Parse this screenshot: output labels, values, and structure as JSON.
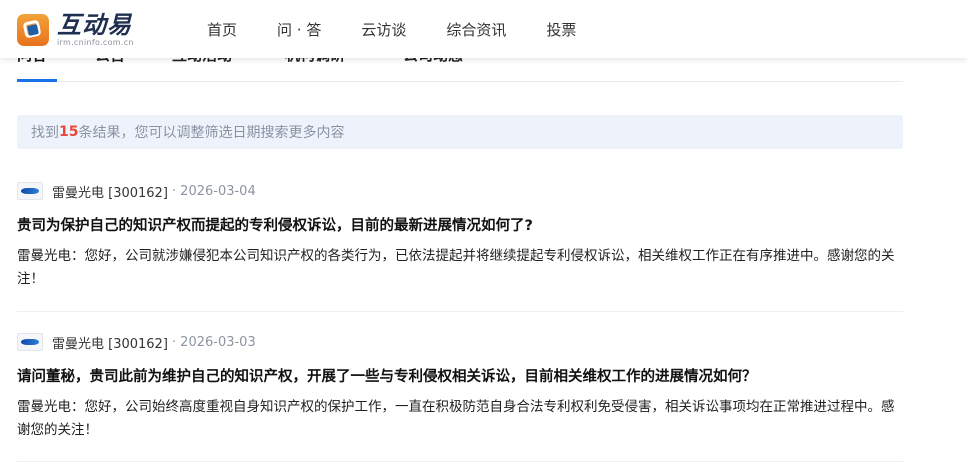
{
  "header": {
    "brand_title": "互动易",
    "brand_sub": "irm.cninfo.com.cn",
    "nav": [
      "首页",
      "问 · 答",
      "云访谈",
      "综合资讯",
      "投票"
    ]
  },
  "tabs": [
    "问答",
    "公告",
    "互动活动",
    "机构调研",
    "公司动态"
  ],
  "notice": {
    "prefix": "找到",
    "count": "15",
    "suffix": "条结果，您可以调整筛选日期搜索更多内容"
  },
  "results": [
    {
      "company": "雷曼光电 [300162]",
      "date": "· 2026-03-04",
      "question": "贵司为保护自己的知识产权而提起的专利侵权诉讼，目前的最新进展情况如何了?",
      "answer": "雷曼光电：您好，公司就涉嫌侵犯本公司知识产权的各类行为，已依法提起并将继续提起专利侵权诉讼，相关维权工作正在有序推进中。感谢您的关注！"
    },
    {
      "company": "雷曼光电 [300162]",
      "date": "· 2026-03-03",
      "question": "请问董秘，贵司此前为维护自己的知识产权，开展了一些与专利侵权相关诉讼，目前相关维权工作的进展情况如何？",
      "answer": "雷曼光电：您好，公司始终高度重视自身知识产权的保护工作，一直在积极防范自身合法专利权利免受侵害，相关诉讼事项均在正常推进过程中。感谢您的关注！"
    }
  ],
  "colors": {
    "accent": "#1a73e8",
    "count_highlight": "#e8483a",
    "notice_bg": "#eef3fb"
  },
  "icons": {
    "brand": "brand-logo-icon",
    "company": "company-logo-icon"
  }
}
